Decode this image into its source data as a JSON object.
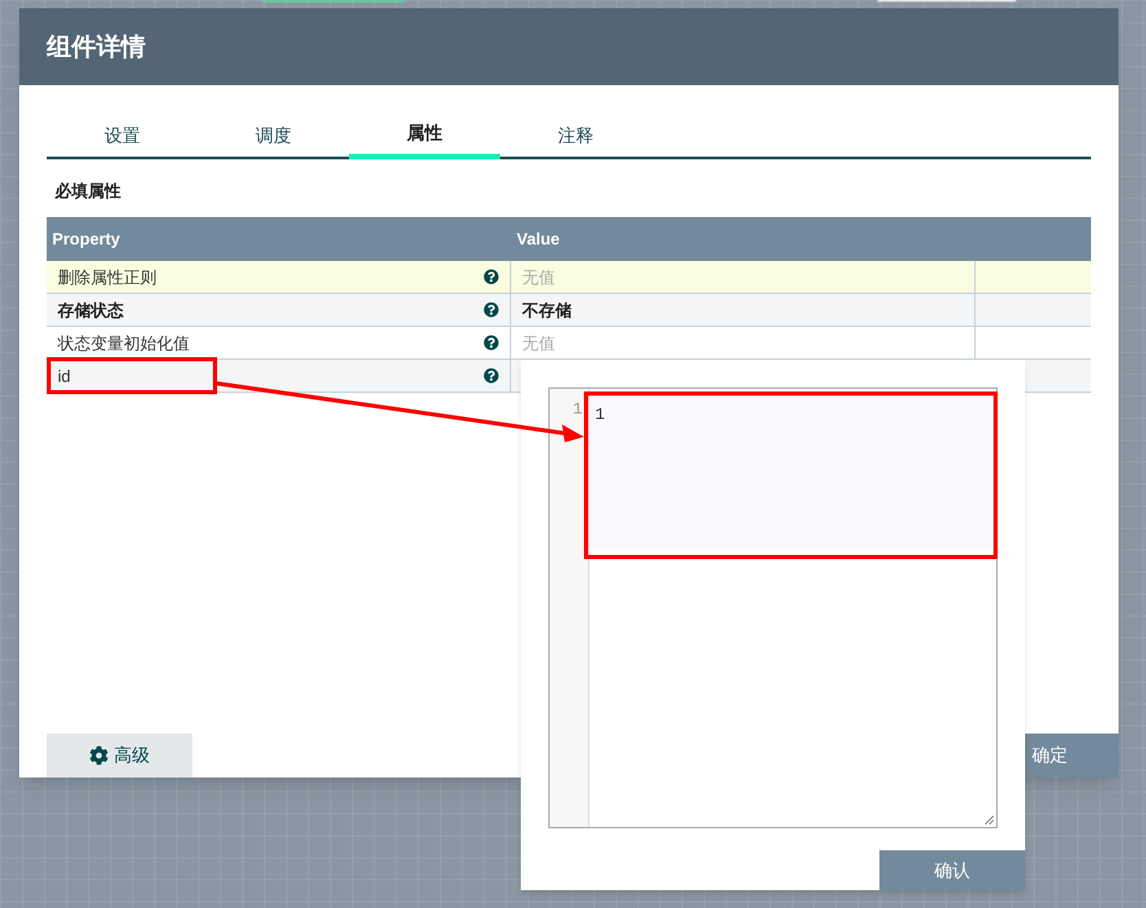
{
  "dialog": {
    "title": "组件详情",
    "tabs": [
      {
        "label": "设置",
        "selected": false
      },
      {
        "label": "调度",
        "selected": false
      },
      {
        "label": "属性",
        "selected": true
      },
      {
        "label": "注释",
        "selected": false
      }
    ],
    "section_title": "必填属性",
    "table": {
      "columns": [
        "Property",
        "Value"
      ],
      "rows": [
        {
          "property": "删除属性正则",
          "value": "无值",
          "required": false,
          "value_set": false,
          "selected": true
        },
        {
          "property": "存储状态",
          "value": "不存储",
          "required": true,
          "value_set": true,
          "selected": false
        },
        {
          "property": "状态变量初始化值",
          "value": "无值",
          "required": false,
          "value_set": false,
          "selected": false
        },
        {
          "property": "id",
          "required": false,
          "selected": false
        }
      ]
    },
    "advanced_button": "高级",
    "ok_button": "确定"
  },
  "editor_popup": {
    "line_numbers": [
      "1"
    ],
    "text": "1",
    "confirm_button": "确认"
  }
}
